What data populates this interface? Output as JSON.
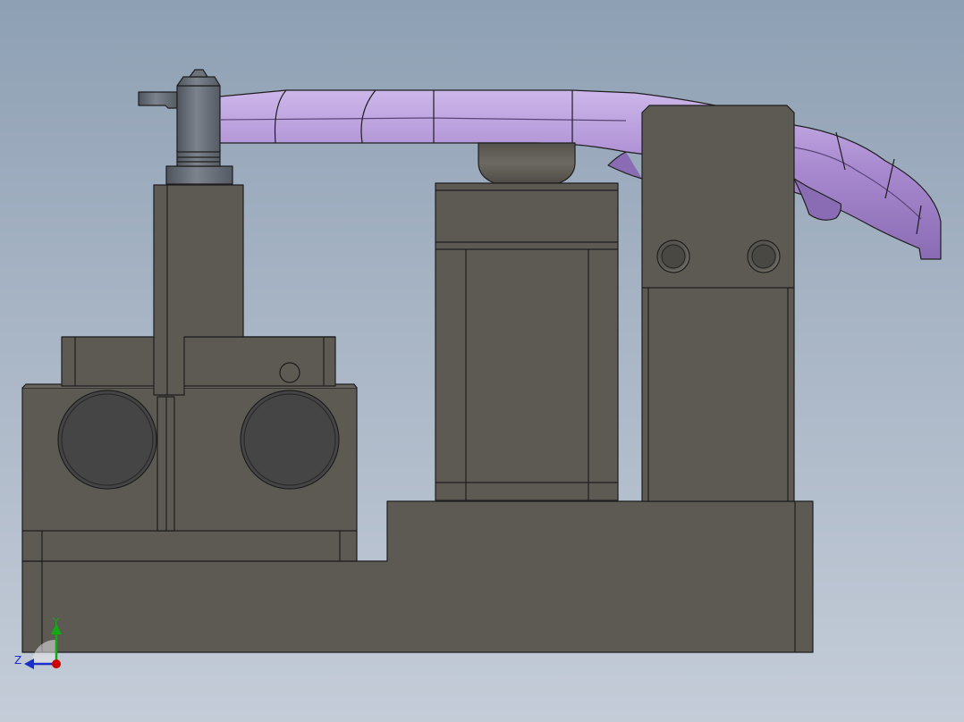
{
  "viewport": {
    "background_top": "#8ea0b4",
    "background_bottom": "#c4ccd8"
  },
  "colors": {
    "body": "#5d5a54",
    "body_light": "#67645d",
    "edge": "#1e1e1e",
    "hole": "#454545",
    "arm": "#a98ad0",
    "arm_light": "#c4aee4",
    "arm_dark": "#7e5fa8",
    "pin": "#6c737d",
    "axis_x": "#cc0000",
    "axis_y": "#11aa11",
    "axis_z": "#1a2ec8"
  },
  "triad": {
    "x_label": "",
    "y_label": "Y",
    "z_label": "Z"
  }
}
